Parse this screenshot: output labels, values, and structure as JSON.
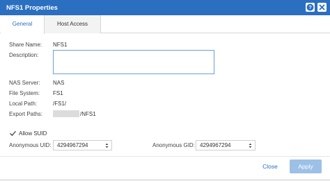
{
  "window": {
    "title": "NFS1 Properties",
    "help_icon": "help-icon",
    "close_icon": "close-icon"
  },
  "tabs": [
    {
      "label": "General",
      "active": true
    },
    {
      "label": "Host Access",
      "active": false
    }
  ],
  "general": {
    "share_name": {
      "label": "Share Name:",
      "value": "NFS1"
    },
    "description": {
      "label": "Description:",
      "value": ""
    },
    "nas_server": {
      "label": "NAS Server:",
      "value": "NAS"
    },
    "file_system": {
      "label": "File System:",
      "value": "FS1"
    },
    "local_path": {
      "label": "Local Path:",
      "value": "/FS1/"
    },
    "export_paths": {
      "label": "Export Paths:",
      "value": "/NFS1"
    },
    "allow_suid": {
      "label": "Allow SUID",
      "checked": true
    },
    "anonymous_uid": {
      "label": "Anonymous UID:",
      "value": "4294967294"
    },
    "anonymous_gid": {
      "label": "Anonymous GID:",
      "value": "4294967294"
    }
  },
  "footer": {
    "close_label": "Close",
    "apply_label": "Apply"
  },
  "colors": {
    "titlebar": "#2b6fc0",
    "accent": "#2b6fc0",
    "apply_disabled": "#9dc0e6"
  }
}
